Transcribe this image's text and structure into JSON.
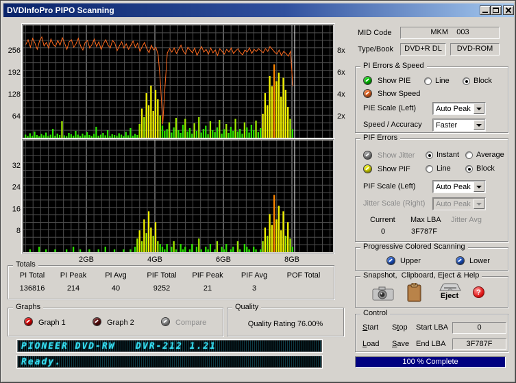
{
  "window": {
    "title": "DVDInfoPro PIPO Scanning"
  },
  "info": {
    "mid_code_label": "MID Code",
    "mid_code": "MKM    003",
    "type_book_label": "Type/Book",
    "type_value": "DVD+R DL",
    "book_value": "DVD-ROM"
  },
  "pi_group": {
    "title": "PI Errors & Speed",
    "show_pie": "Show PIE",
    "line": "Line",
    "block": "Block",
    "show_speed": "Show Speed",
    "pie_scale_label": "PIE Scale (Left)",
    "pie_scale_value": "Auto Peak",
    "speed_accuracy_label": "Speed / Accuracy",
    "speed_accuracy_value": "Faster"
  },
  "pif_group": {
    "title": "PIF Errors",
    "show_jitter": "Show Jitter",
    "instant": "Instant",
    "average": "Average",
    "show_pif": "Show PIF",
    "line": "Line",
    "block": "Block",
    "pif_scale_label": "PIF Scale (Left)",
    "pif_scale_value": "Auto Peak",
    "jitter_scale_label": "Jitter Scale (Right)",
    "jitter_scale_value": "Auto Peak",
    "current_label": "Current",
    "current_value": "0",
    "max_lba_label": "Max LBA",
    "max_lba_value": "3F787F",
    "jitter_avg_label": "Jitter Avg"
  },
  "progressive": {
    "title": "Progressive Colored Scanning",
    "upper": "Upper",
    "lower": "Lower"
  },
  "snapshot": {
    "title": "Snapshot,  Clipboard, Eject & Help",
    "eject_label": "Eject"
  },
  "control": {
    "title": "Control",
    "start": {
      "pre": "",
      "u": "S",
      "rest": "tart"
    },
    "stop": {
      "pre": "S",
      "u": "t",
      "rest": "op"
    },
    "load": {
      "pre": "",
      "u": "L",
      "rest": "oad"
    },
    "save": {
      "pre": "",
      "u": "S",
      "rest": "ave"
    },
    "start_lba_label": "Start LBA",
    "start_lba_value": "0",
    "end_lba_label": "End LBA",
    "end_lba_value": "3F787F"
  },
  "progress": {
    "text": "100 % Complete"
  },
  "totals": {
    "title": "Totals",
    "columns": [
      "PI Total",
      "PI Peak",
      "PI Avg",
      "PIF Total",
      "PIF Peak",
      "PIF Avg",
      "POF Total"
    ],
    "values": [
      "136816",
      "214",
      "40",
      "9252",
      "21",
      "3",
      ""
    ]
  },
  "graphs": {
    "title": "Graphs",
    "graph1": "Graph 1",
    "graph2": "Graph 2",
    "compare": "Compare"
  },
  "quality": {
    "title": "Quality",
    "rating": "Quality Rating 76.00%"
  },
  "lcd": {
    "line1": "PIONEER DVD-RW   DVR-212 1.21",
    "line2": "Ready."
  },
  "colors": {
    "pie_led": "#00c800",
    "speed_led": "#e8641e",
    "jitter_led": "#909090",
    "pif_led": "#e6e600",
    "upper_led": "#1e56c8",
    "lower_led": "#1e56c8",
    "graph1_led": "#e00000",
    "graph2_led": "#5c0a0a",
    "compare_led": "#9a9a9a"
  },
  "chart_data": {
    "type": "bar",
    "x_axis": {
      "ticks": [
        {
          "label": "2GB",
          "gb": 2
        },
        {
          "label": "4GB",
          "gb": 4
        },
        {
          "label": "6GB",
          "gb": 6
        },
        {
          "label": "8GB",
          "gb": 8
        }
      ],
      "gb_max": 9.2
    },
    "cursor_gb": 8.08,
    "scan_start_gb": 0.18,
    "scan_end_gb": 8.08,
    "top_plot": {
      "name": "PIE errors (bars) and read speed (line)",
      "left_ticks": [
        256,
        192,
        128,
        64
      ],
      "left_max": 328,
      "right_ticks": [
        {
          "label": "8x",
          "value": 256
        },
        {
          "label": "6x",
          "value": 192
        },
        {
          "label": "4x",
          "value": 128
        },
        {
          "label": "2x",
          "value": 64
        }
      ],
      "pie_values": [
        9,
        5,
        13,
        6,
        18,
        8,
        4,
        11,
        7,
        15,
        5,
        9,
        26,
        6,
        12,
        8,
        48,
        7,
        5,
        14,
        10,
        6,
        20,
        9,
        5,
        12,
        7,
        16,
        8,
        5,
        11,
        32,
        6,
        9,
        14,
        7,
        22,
        5,
        10,
        8,
        6,
        13,
        9,
        5,
        17,
        7,
        28,
        6,
        11,
        8,
        40,
        85,
        60,
        130,
        95,
        152,
        78,
        140,
        112,
        65,
        35,
        20,
        25,
        45,
        15,
        30,
        58,
        22,
        14,
        38,
        55,
        18,
        28,
        12,
        42,
        20,
        60,
        15,
        26,
        35,
        10,
        48,
        22,
        16,
        30,
        52,
        12,
        25,
        40,
        14,
        32,
        20,
        55,
        18,
        26,
        12,
        45,
        30,
        15,
        38,
        22,
        50,
        16,
        28,
        70,
        130,
        95,
        180,
        150,
        214,
        165,
        190,
        120,
        175,
        140,
        90,
        55,
        25
      ],
      "speed_values": [
        272,
        286,
        264,
        290,
        276,
        258,
        282,
        294,
        268,
        278,
        262,
        288,
        272,
        266,
        284,
        270,
        292,
        276,
        258,
        280,
        286,
        264,
        274,
        290,
        268,
        256,
        278,
        284,
        262,
        272,
        288,
        266,
        280,
        258,
        274,
        286,
        270,
        262,
        284,
        276,
        254,
        268,
        280,
        262,
        274,
        258,
        270,
        282,
        264,
        276,
        252,
        266,
        278,
        260,
        248,
        270,
        256,
        264,
        242,
        160,
        40,
        150,
        248,
        260,
        250,
        262,
        246,
        258,
        270,
        252,
        244,
        264,
        256,
        248,
        262,
        240,
        254,
        266,
        250,
        258,
        244,
        262,
        248,
        256,
        240,
        260,
        252,
        244,
        258,
        250,
        262,
        246,
        254,
        260,
        248,
        242,
        256,
        250,
        262,
        246,
        258,
        252,
        260,
        254,
        248,
        260,
        252,
        266,
        258,
        250,
        244,
        256,
        240,
        252,
        246,
        238,
        252,
        150
      ]
    },
    "bottom_plot": {
      "name": "PIF errors (bars)",
      "left_ticks": [
        32,
        24,
        16,
        8
      ],
      "left_max": 41,
      "pif_values": [
        0,
        0,
        1,
        0,
        0,
        0,
        2,
        0,
        0,
        1,
        0,
        0,
        0,
        1,
        0,
        0,
        0,
        0,
        1,
        0,
        0,
        2,
        0,
        0,
        1,
        0,
        0,
        0,
        1,
        0,
        0,
        0,
        1,
        0,
        0,
        2,
        0,
        0,
        0,
        1,
        0,
        0,
        0,
        1,
        0,
        0,
        1,
        0,
        2,
        5,
        8,
        4,
        12,
        7,
        15,
        9,
        6,
        11,
        4,
        3,
        2,
        1,
        3,
        0,
        2,
        4,
        1,
        0,
        3,
        1,
        2,
        0,
        1,
        3,
        0,
        2,
        5,
        1,
        0,
        2,
        1,
        3,
        0,
        1,
        4,
        0,
        2,
        1,
        3,
        0,
        1,
        2,
        0,
        4,
        1,
        0,
        3,
        2,
        1,
        0,
        2,
        1,
        0,
        1,
        4,
        9,
        6,
        14,
        10,
        21,
        12,
        17,
        8,
        15,
        6,
        11,
        5,
        2
      ]
    },
    "colors": {
      "plot_bg": "#000000",
      "grid": "#4f4f4f",
      "grid_major": "#b4b4b4",
      "pie_green": "#2ce000",
      "pie_mid": "#a0e800",
      "pie_yellow": "#f0f000",
      "peak_orange": "#ff8800",
      "speed": "#ff6a1e",
      "cursor": "#ffffff"
    }
  }
}
